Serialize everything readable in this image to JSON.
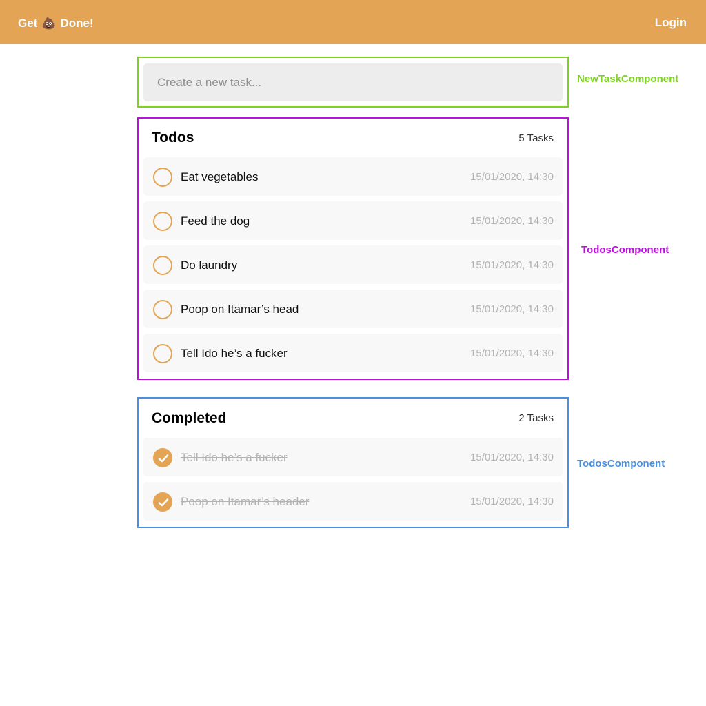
{
  "header": {
    "brand_prefix": "Get",
    "brand_emoji": "💩",
    "brand_suffix": "Done!",
    "login_label": "Login",
    "background_color": "#e3a555"
  },
  "new_task": {
    "placeholder": "Create a new task...",
    "value": "",
    "annotation": "NewTaskComponent"
  },
  "todos": {
    "title": "Todos",
    "count_label": "5 Tasks",
    "annotation": "TodosComponent",
    "items": [
      {
        "text": "Eat vegetables",
        "date": "15/01/2020, 14:30",
        "done": false
      },
      {
        "text": "Feed the dog",
        "date": "15/01/2020, 14:30",
        "done": false
      },
      {
        "text": "Do laundry",
        "date": "15/01/2020, 14:30",
        "done": false
      },
      {
        "text": "Poop on Itamar’s head",
        "date": "15/01/2020, 14:30",
        "done": false
      },
      {
        "text": "Tell Ido he’s a fucker",
        "date": "15/01/2020, 14:30",
        "done": false
      }
    ]
  },
  "completed": {
    "title": "Completed",
    "count_label": "2 Tasks",
    "annotation": "TodosComponent",
    "items": [
      {
        "text": "Tell Ido he’s a fucker ",
        "date": "15/01/2020, 14:30",
        "done": true
      },
      {
        "text": "Poop on Itamar’s header ",
        "date": "15/01/2020, 14:30",
        "done": true
      }
    ]
  },
  "colors": {
    "accent": "#e3a555",
    "annotation_new_task": "#7ed321",
    "annotation_todos": "#bd10e0",
    "annotation_completed": "#4a90e2"
  },
  "icons": {
    "unchecked": "empty-circle-icon",
    "checked": "check-circle-icon"
  }
}
